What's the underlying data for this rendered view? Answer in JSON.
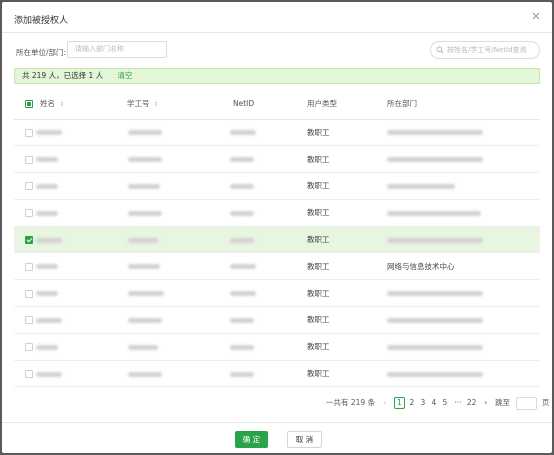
{
  "dialog": {
    "title": "添加被授权人",
    "close_glyph": "✕"
  },
  "filter": {
    "dept_label": "所在单位/部门:",
    "dept_placeholder": "请输入部门名称",
    "search_placeholder": "按姓名/学工号/NetId查询"
  },
  "summary": {
    "text": "共 219 人，已选择 1 人",
    "clear_label": "清空"
  },
  "table": {
    "headers": {
      "name": "姓名",
      "staff_id": "学工号",
      "netid": "NetID",
      "user_type": "用户类型",
      "dept": "所在部门"
    },
    "sort_glyph": "⇕",
    "rows": [
      {
        "user_type": "教职工",
        "dept": "",
        "selected": false
      },
      {
        "user_type": "教职工",
        "dept": "",
        "selected": false
      },
      {
        "user_type": "教职工",
        "dept": "",
        "selected": false
      },
      {
        "user_type": "教职工",
        "dept": "",
        "selected": false
      },
      {
        "user_type": "教职工",
        "dept": "",
        "selected": true
      },
      {
        "user_type": "教职工",
        "dept": "网络与信息技术中心",
        "selected": false
      },
      {
        "user_type": "教职工",
        "dept": "",
        "selected": false
      },
      {
        "user_type": "教职工",
        "dept": "",
        "selected": false
      },
      {
        "user_type": "教职工",
        "dept": "",
        "selected": false
      },
      {
        "user_type": "教职工",
        "dept": "",
        "selected": false
      }
    ]
  },
  "pagination": {
    "total_text": "一共有 219 条",
    "prev_glyph": "‹",
    "next_glyph": "›",
    "pages": [
      "1",
      "2",
      "3",
      "4",
      "5"
    ],
    "ellipsis": "···",
    "last_page": "22",
    "current_page": "1",
    "jump_label": "跳至",
    "page_unit": "页"
  },
  "footer": {
    "ok_label": "确 定",
    "cancel_label": "取 消"
  },
  "colors": {
    "accent": "#2aa34a",
    "summary_bg": "#e3f6d8",
    "selected_row_bg": "#e8f5e1"
  }
}
